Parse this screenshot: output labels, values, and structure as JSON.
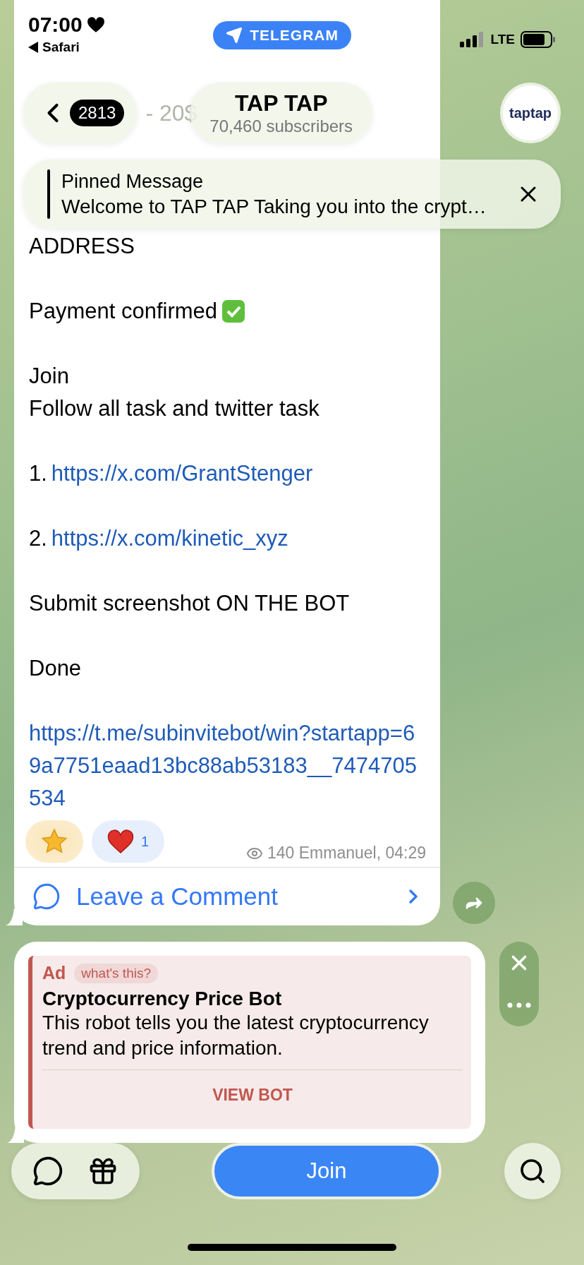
{
  "status_bar": {
    "time": "07:00",
    "back_app": "Safari",
    "app_badge": "TELEGRAM",
    "network": "LTE"
  },
  "header": {
    "unread_count": "2813",
    "behind_text": "- 20$",
    "title": "TAP TAP",
    "subtitle": "70,460 subscribers",
    "avatar_text": "taptap"
  },
  "pinned": {
    "label": "Pinned Message",
    "text": "Welcome to TAP TAP Taking you into the crypt…"
  },
  "post": {
    "blocks": [
      {
        "kind": "text",
        "text": "ADDRESS"
      },
      {
        "kind": "gap"
      },
      {
        "kind": "text_check",
        "text": "Payment confirmed"
      },
      {
        "kind": "gap"
      },
      {
        "kind": "text",
        "text": "Join"
      },
      {
        "kind": "text",
        "text": "Follow all task and twitter task"
      },
      {
        "kind": "gap"
      },
      {
        "kind": "numbered_link",
        "number": "1.",
        "url": "https://x.com/GrantStenger"
      },
      {
        "kind": "gap"
      },
      {
        "kind": "numbered_link",
        "number": "2.",
        "url": "https://x.com/kinetic_xyz"
      },
      {
        "kind": "gap"
      },
      {
        "kind": "text",
        "text": "Submit screenshot ON THE BOT"
      },
      {
        "kind": "gap"
      },
      {
        "kind": "text",
        "text": "Done"
      },
      {
        "kind": "gap"
      },
      {
        "kind": "link",
        "url": "https://t.me/subinvitebot/win?startapp=69a7751eaad13bc88ab53183__7474705534"
      }
    ],
    "reactions": [
      {
        "kind": "star"
      },
      {
        "kind": "heart",
        "count": "1"
      }
    ],
    "views": "140",
    "signature": "Emmanuel, 04:29",
    "comment_label": "Leave a Comment"
  },
  "ad": {
    "label": "Ad",
    "info": "what's this?",
    "title": "Cryptocurrency Price Bot",
    "text": "This robot tells you the latest cryptocurrency trend and price information.",
    "button": "VIEW BOT"
  },
  "bottom_bar": {
    "join": "Join"
  }
}
